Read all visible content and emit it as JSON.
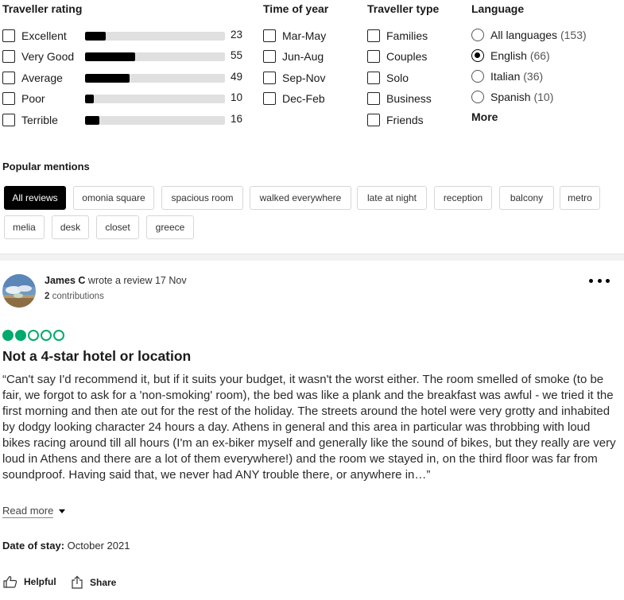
{
  "filters": {
    "traveller_rating": {
      "title": "Traveller rating",
      "items": [
        {
          "label": "Excellent",
          "count": "23",
          "fraction": 0.15
        },
        {
          "label": "Very Good",
          "count": "55",
          "fraction": 0.36
        },
        {
          "label": "Average",
          "count": "49",
          "fraction": 0.32
        },
        {
          "label": "Poor",
          "count": "10",
          "fraction": 0.065
        },
        {
          "label": "Terrible",
          "count": "16",
          "fraction": 0.105
        }
      ]
    },
    "time_of_year": {
      "title": "Time of year",
      "items": [
        {
          "label": "Mar-May"
        },
        {
          "label": "Jun-Aug"
        },
        {
          "label": "Sep-Nov"
        },
        {
          "label": "Dec-Feb"
        }
      ]
    },
    "traveller_type": {
      "title": "Traveller type",
      "items": [
        {
          "label": "Families"
        },
        {
          "label": "Couples"
        },
        {
          "label": "Solo"
        },
        {
          "label": "Business"
        },
        {
          "label": "Friends"
        }
      ]
    },
    "language": {
      "title": "Language",
      "items": [
        {
          "label": "All languages",
          "count": "(153)",
          "selected": false
        },
        {
          "label": "English",
          "count": "(66)",
          "selected": true
        },
        {
          "label": "Italian",
          "count": "(36)",
          "selected": false
        },
        {
          "label": "Spanish",
          "count": "(10)",
          "selected": false
        }
      ],
      "more_label": "More"
    }
  },
  "popular_mentions": {
    "title": "Popular mentions",
    "chips": [
      "All reviews",
      "omonia square",
      "spacious room",
      "walked everywhere",
      "late at night",
      "reception",
      "balcony",
      "metro",
      "melia",
      "desk",
      "closet",
      "greece"
    ],
    "active_index": 0
  },
  "review": {
    "author": "James C",
    "action_text": "wrote a review 17 Nov",
    "contributions_count": "2",
    "contributions_label": "contributions",
    "rating": 2,
    "rating_max": 5,
    "title": "Not a 4-star hotel or location",
    "body": "“Can't say I'd recommend it, but if it suits your budget, it wasn't the worst either. The room smelled of smoke (to be fair, we forgot to ask for a 'non-smoking' room), the bed was like a plank and the breakfast was awful - we tried it the first morning and then ate out for the rest of the holiday. The streets around the hotel were very grotty and inhabited by dodgy looking character 24 hours a day. Athens in general and this area in particular was throbbing with loud bikes racing around till all hours (I'm an ex-biker myself and generally like the sound of bikes, but they really are very loud in Athens and there are a lot of them everywhere!) and the room we stayed in, on the third floor was far from soundproof. Having said that, we never had ANY trouble there, or anywhere in…”",
    "read_more_label": "Read more",
    "date_of_stay_label": "Date of stay:",
    "date_of_stay_value": "October 2021",
    "helpful_label": "Helpful",
    "share_label": "Share"
  },
  "colors": {
    "accent_green": "#00aa6c",
    "bar_fill": "#000000",
    "bar_track": "#e0e0e0",
    "active_chip": "#000000"
  },
  "icons": [
    "more-options-icon",
    "thumbs-up-icon",
    "share-icon",
    "chevron-down-icon"
  ]
}
